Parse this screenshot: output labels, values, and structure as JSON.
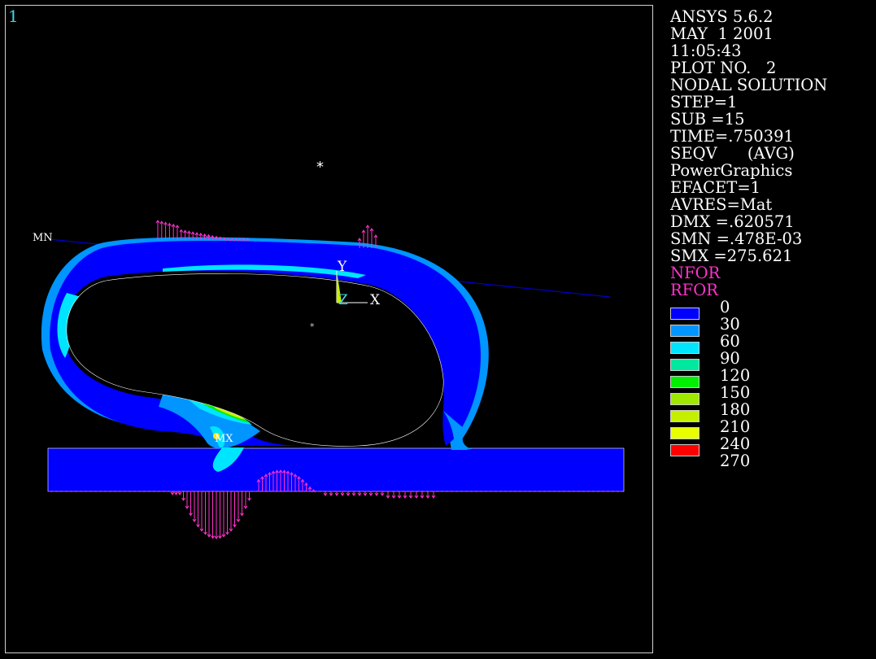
{
  "window_number": "1",
  "header_lines": [
    "ANSYS 5.6.2",
    "MAY  1 2001",
    "11:05:43",
    "PLOT NO.   2",
    "NODAL SOLUTION",
    "STEP=1",
    "SUB =15",
    "TIME=.750391",
    "SEQV      (AVG)",
    "PowerGraphics",
    "EFACET=1",
    "AVRES=Mat",
    "DMX =.620571",
    "SMN =.478E-03",
    "SMX =275.621"
  ],
  "force_labels": [
    "NFOR",
    "RFOR"
  ],
  "legend": [
    {
      "value": "0",
      "color": "#0000ff"
    },
    {
      "value": "30",
      "color": "#0095ff"
    },
    {
      "value": "60",
      "color": "#00e5ff"
    },
    {
      "value": "90",
      "color": "#00e8a0"
    },
    {
      "value": "120",
      "color": "#00ee00"
    },
    {
      "value": "150",
      "color": "#a0e800"
    },
    {
      "value": "180",
      "color": "#c4f000"
    },
    {
      "value": "210",
      "color": "#e8ff00"
    },
    {
      "value": "240",
      "color": "#ffea00"
    },
    {
      "value": "270",
      "color": "#ff0000"
    }
  ],
  "plot_labels": {
    "min_marker": "MN",
    "max_marker": "MX",
    "axis_y": "Y",
    "axis_z": "Z",
    "axis_x": "X"
  },
  "colors": {
    "background": "#000000",
    "frame": "#d0d0d0",
    "window_number": "#3fd8e8",
    "force_vectors": "#ff33cc",
    "contact_line": "#0000cc"
  }
}
